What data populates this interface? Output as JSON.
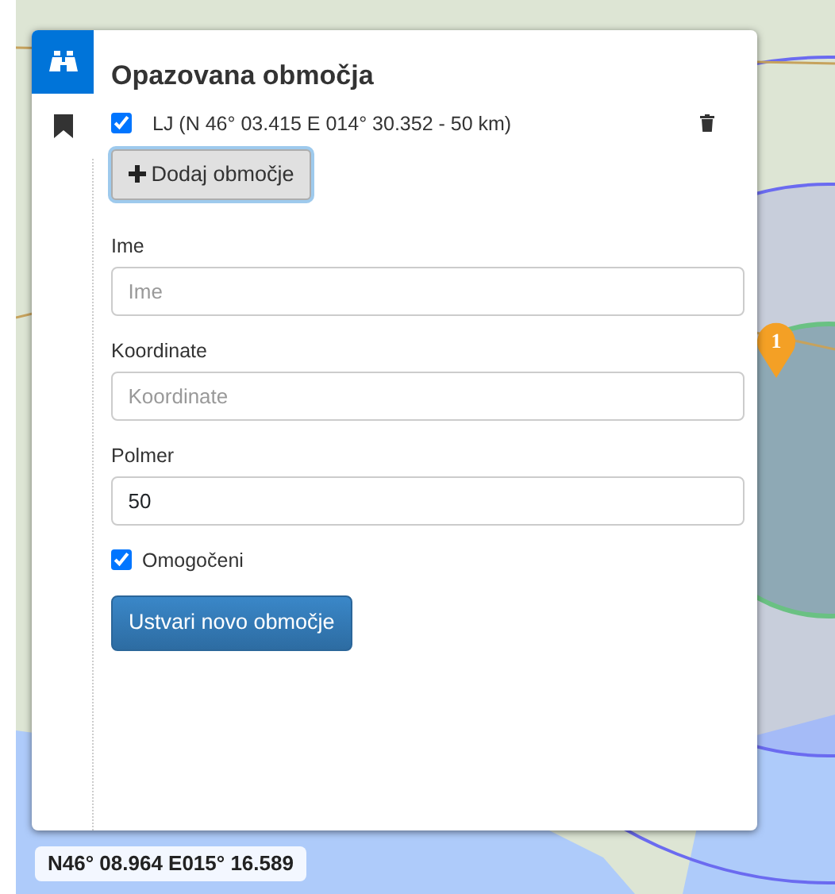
{
  "sidebar": {
    "tabs": [
      {
        "kind": "binoculars",
        "selected": true
      },
      {
        "kind": "bookmark",
        "selected": false
      }
    ]
  },
  "panel": {
    "title": "Opazovana območja",
    "areas": [
      {
        "label": "LJ (N 46° 03.415 E 014° 30.352 - 50 km)",
        "checked": true
      }
    ],
    "add_button": "Dodaj območje",
    "fields": [
      {
        "label": "Ime",
        "placeholder": "Ime"
      },
      {
        "label": "Koordinate",
        "placeholder": "Koordinate"
      },
      {
        "label": "Polmer",
        "value": "50"
      }
    ],
    "enabled": {
      "label": "Omogočeni",
      "checked": true
    },
    "submit_button": "Ustvari novo območje"
  },
  "map": {
    "markers": [
      {
        "count": "1"
      }
    ],
    "coordinates": "N46° 08.964 E015° 16.589"
  }
}
